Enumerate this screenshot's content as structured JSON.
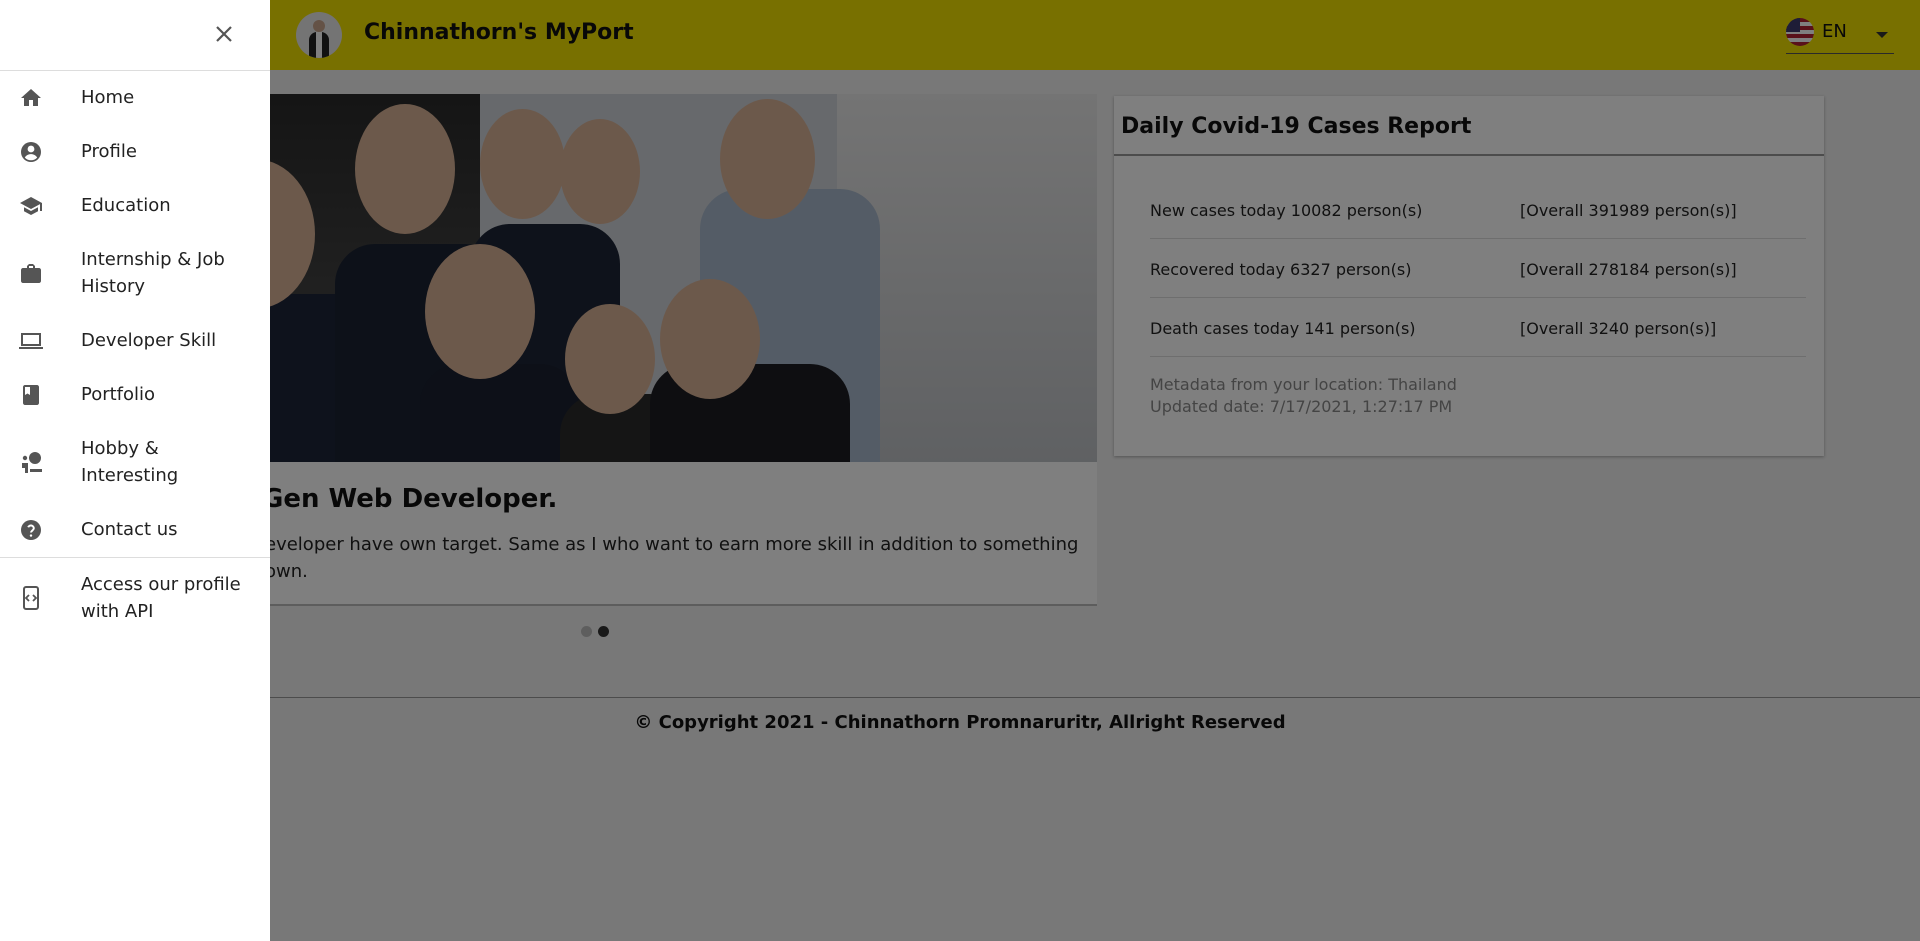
{
  "app": {
    "title": "Chinnathorn's MyPort",
    "language": "EN"
  },
  "carousel": {
    "title": "Gen Web Developer.",
    "text": "eveloper have own target. Same as I who want to earn more skill in addition to something own.",
    "dots": 2,
    "active_dot": 2
  },
  "covid": {
    "title": "Daily Covid-19 Cases Report",
    "rows": [
      {
        "today": "New cases today 10082 person(s)",
        "overall": "[Overall 391989 person(s)]"
      },
      {
        "today": "Recovered today 6327 person(s)",
        "overall": "[Overall 278184 person(s)]"
      },
      {
        "today": "Death cases today 141 person(s)",
        "overall": "[Overall 3240 person(s)]"
      }
    ],
    "metadata_location": "Metadata from your location: Thailand",
    "updated_date": "Updated date: 7/17/2021, 1:27:17 PM"
  },
  "footer": {
    "copyright": "© Copyright 2021 - Chinnathorn Promnaruritr, Allright Reserved"
  },
  "drawer": {
    "close_icon": "close-icon",
    "items": [
      {
        "label": "Home",
        "icon": "home-icon"
      },
      {
        "label": "Profile",
        "icon": "account-circle-icon"
      },
      {
        "label": "Education",
        "icon": "school-icon"
      },
      {
        "label": "Internship & Job History",
        "icon": "briefcase-icon"
      },
      {
        "label": "Developer Skill",
        "icon": "laptop-icon"
      },
      {
        "label": "Portfolio",
        "icon": "book-icon"
      },
      {
        "label": "Hobby & Interesting",
        "icon": "hobby-icon"
      },
      {
        "label": "Contact us",
        "icon": "help-circle-icon"
      }
    ],
    "api_item": {
      "label": "Access our profile with API",
      "icon": "api-icon"
    }
  },
  "colors": {
    "appbar": "#f0e000",
    "overlay": "rgba(0,0,0,0.5)",
    "drawer": "#ffffff"
  }
}
